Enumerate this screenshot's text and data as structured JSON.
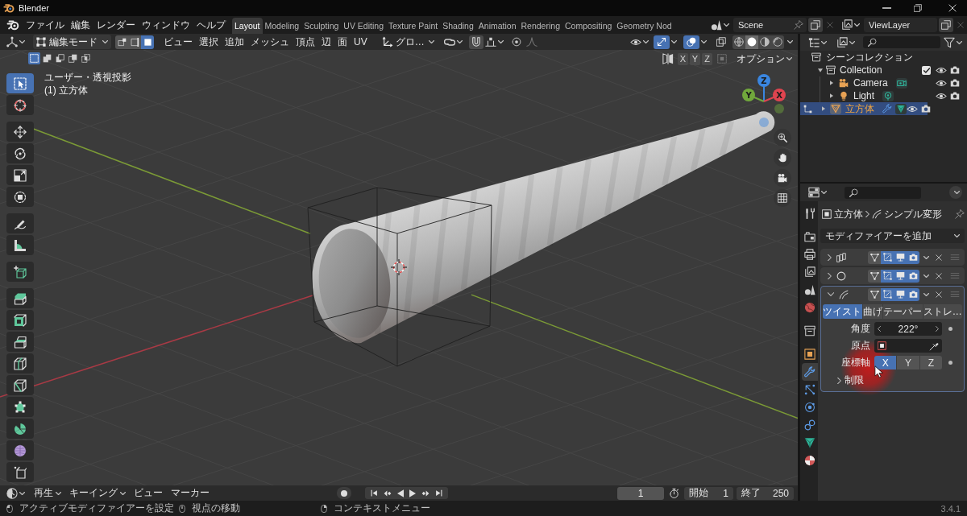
{
  "window": {
    "title": "Blender"
  },
  "menu_bar": {
    "menus": [
      "ファイル",
      "編集",
      "レンダー",
      "ウィンドウ",
      "ヘルプ"
    ]
  },
  "workspaces": [
    {
      "label": "Layout",
      "selected": true
    },
    {
      "label": "Modeling",
      "selected": false
    },
    {
      "label": "Sculpting",
      "selected": false
    },
    {
      "label": "UV Editing",
      "selected": false
    },
    {
      "label": "Texture Paint",
      "selected": false
    },
    {
      "label": "Shading",
      "selected": false
    },
    {
      "label": "Animation",
      "selected": false
    },
    {
      "label": "Rendering",
      "selected": false
    },
    {
      "label": "Compositing",
      "selected": false
    },
    {
      "label": "Geometry Nod",
      "selected": false
    }
  ],
  "scene": {
    "name": "Scene"
  },
  "view_layer": {
    "name": "ViewLayer"
  },
  "viewport_header": {
    "mode": "編集モード",
    "select_modes": [
      {
        "kind": "vertex",
        "selected": false
      },
      {
        "kind": "edge",
        "selected": false
      },
      {
        "kind": "face",
        "selected": true
      }
    ],
    "menus": [
      "ビュー",
      "選択",
      "追加",
      "メッシュ",
      "頂点",
      "辺",
      "面",
      "UV"
    ],
    "orientation": "グロ…",
    "toggles": [
      {
        "kind": "gizmo",
        "on": true
      },
      {
        "kind": "overlay",
        "on": true
      },
      {
        "kind": "xray",
        "on": false
      }
    ],
    "shading": [
      {
        "kind": "wireframe",
        "selected": false
      },
      {
        "kind": "solid",
        "selected": true
      },
      {
        "kind": "material",
        "selected": false
      },
      {
        "kind": "rendered",
        "selected": false
      }
    ],
    "selection_ops": [
      {
        "kind": "set",
        "selected": true
      },
      {
        "kind": "extend",
        "selected": false
      },
      {
        "kind": "subtract",
        "selected": false
      },
      {
        "kind": "invert",
        "selected": false
      },
      {
        "kind": "intersect",
        "selected": false
      }
    ],
    "mirror_axes": [
      {
        "label": "X",
        "selected": false
      },
      {
        "label": "Y",
        "selected": false
      },
      {
        "label": "Z",
        "selected": false
      }
    ],
    "options": "オプション"
  },
  "viewport": {
    "view_name": "ユーザー・透視投影",
    "object_label": "(1) 立方体",
    "gizmo_axes": [
      {
        "label": "Z",
        "color": "#3a86e0"
      },
      {
        "label": "Y",
        "color": "#71a83c"
      },
      {
        "label": "X",
        "color": "#e0444f"
      }
    ]
  },
  "toolbar": {
    "groups": [
      {
        "tools": [
          {
            "kind": "select_box",
            "selected": true
          },
          {
            "kind": "cursor",
            "selected": false
          }
        ]
      },
      {
        "tools": [
          {
            "kind": "move",
            "selected": false
          },
          {
            "kind": "rotate",
            "selected": false
          },
          {
            "kind": "scale",
            "selected": false
          },
          {
            "kind": "transform",
            "selected": false
          }
        ]
      },
      {
        "tools": [
          {
            "kind": "annotate",
            "selected": false
          },
          {
            "kind": "measure",
            "selected": false
          }
        ]
      },
      {
        "tools": [
          {
            "kind": "add_cube",
            "selected": false
          }
        ]
      },
      {
        "tools": [
          {
            "kind": "extrude",
            "selected": false
          },
          {
            "kind": "inset",
            "selected": false
          },
          {
            "kind": "bevel",
            "selected": false
          },
          {
            "kind": "loop_cut",
            "selected": false
          },
          {
            "kind": "knife",
            "selected": false
          },
          {
            "kind": "poly_build",
            "selected": false
          },
          {
            "kind": "spin",
            "selected": false
          },
          {
            "kind": "smooth",
            "selected": false
          },
          {
            "kind": "shear",
            "selected": false
          }
        ]
      }
    ]
  },
  "outliner": {
    "root": "シーンコレクション",
    "collections": [
      {
        "name": "Collection",
        "expanded": true,
        "checked": true,
        "children": [
          {
            "name": "Camera",
            "kind": "camera",
            "selected": false,
            "expanded": false,
            "modifier": false
          },
          {
            "name": "Light",
            "kind": "light",
            "selected": false,
            "expanded": false,
            "modifier": false
          },
          {
            "name": "立方体",
            "kind": "mesh",
            "selected": true,
            "expanded": false,
            "modifier": true
          }
        ]
      }
    ]
  },
  "properties": {
    "tab_groups": [
      {
        "tabs": [
          {
            "kind": "tool",
            "selected": false
          }
        ]
      },
      {
        "tabs": [
          {
            "kind": "render",
            "selected": false
          },
          {
            "kind": "output",
            "selected": false
          },
          {
            "kind": "view_layer",
            "selected": false
          },
          {
            "kind": "scene",
            "selected": false
          },
          {
            "kind": "world",
            "selected": false
          }
        ]
      },
      {
        "tabs": [
          {
            "kind": "collection",
            "selected": false
          }
        ]
      },
      {
        "tabs": [
          {
            "kind": "object",
            "selected": false
          },
          {
            "kind": "modifier",
            "selected": true
          },
          {
            "kind": "particles",
            "selected": false
          },
          {
            "kind": "physics",
            "selected": false
          },
          {
            "kind": "constraints",
            "selected": false
          },
          {
            "kind": "data",
            "selected": false
          },
          {
            "kind": "material",
            "selected": false
          }
        ]
      }
    ],
    "breadcrumb": {
      "object": "立方体",
      "modifier": "シンプル変形"
    },
    "add_modifier": "モディファイアーを追加",
    "modifiers": [
      {
        "kind": "array",
        "expanded": false,
        "active": false,
        "toggles": [
          {
            "kind": "edit_mode",
            "on": false
          },
          {
            "kind": "on_cage",
            "on": true
          },
          {
            "kind": "realtime",
            "on": true
          },
          {
            "kind": "render",
            "on": true
          }
        ]
      },
      {
        "kind": "subdivision",
        "expanded": false,
        "active": false,
        "toggles": [
          {
            "kind": "edit_mode",
            "on": false
          },
          {
            "kind": "on_cage",
            "on": true
          },
          {
            "kind": "realtime",
            "on": true
          },
          {
            "kind": "render",
            "on": true
          }
        ]
      },
      {
        "kind": "simple_deform",
        "expanded": true,
        "active": true,
        "toggles": [
          {
            "kind": "edit_mode",
            "on": false
          },
          {
            "kind": "on_cage",
            "on": true
          },
          {
            "kind": "realtime",
            "on": true
          },
          {
            "kind": "render",
            "on": true
          }
        ],
        "methods": [
          {
            "label": "ツイスト",
            "selected": true
          },
          {
            "label": "曲げ",
            "selected": false
          },
          {
            "label": "テーパー",
            "selected": false
          },
          {
            "label": "ストレ…",
            "selected": false
          }
        ],
        "angle": {
          "label": "角度",
          "value": "222°"
        },
        "origin": {
          "label": "原点"
        },
        "axis": {
          "label": "座標軸",
          "axes": [
            {
              "label": "X",
              "selected": true
            },
            {
              "label": "Y",
              "selected": false
            },
            {
              "label": "Z",
              "selected": false
            }
          ]
        },
        "limits": {
          "label": "制限",
          "expanded": false
        }
      }
    ]
  },
  "timeline": {
    "menus": [
      {
        "label": "再生",
        "dropdown": true
      },
      {
        "label": "キーイング",
        "dropdown": true
      },
      {
        "label": "ビュー",
        "dropdown": false
      },
      {
        "label": "マーカー",
        "dropdown": false
      }
    ],
    "current_frame": "1",
    "start": {
      "label": "開始",
      "value": "1"
    },
    "end": {
      "label": "終了",
      "value": "250"
    }
  },
  "status_bar": {
    "hints": [
      {
        "kind": "left",
        "text": "アクティブモディファイアーを設定"
      },
      {
        "kind": "middle",
        "text": "視点の移動"
      },
      {
        "kind": "right",
        "text": "コンテキストメニュー"
      }
    ],
    "version": "3.4.1"
  }
}
